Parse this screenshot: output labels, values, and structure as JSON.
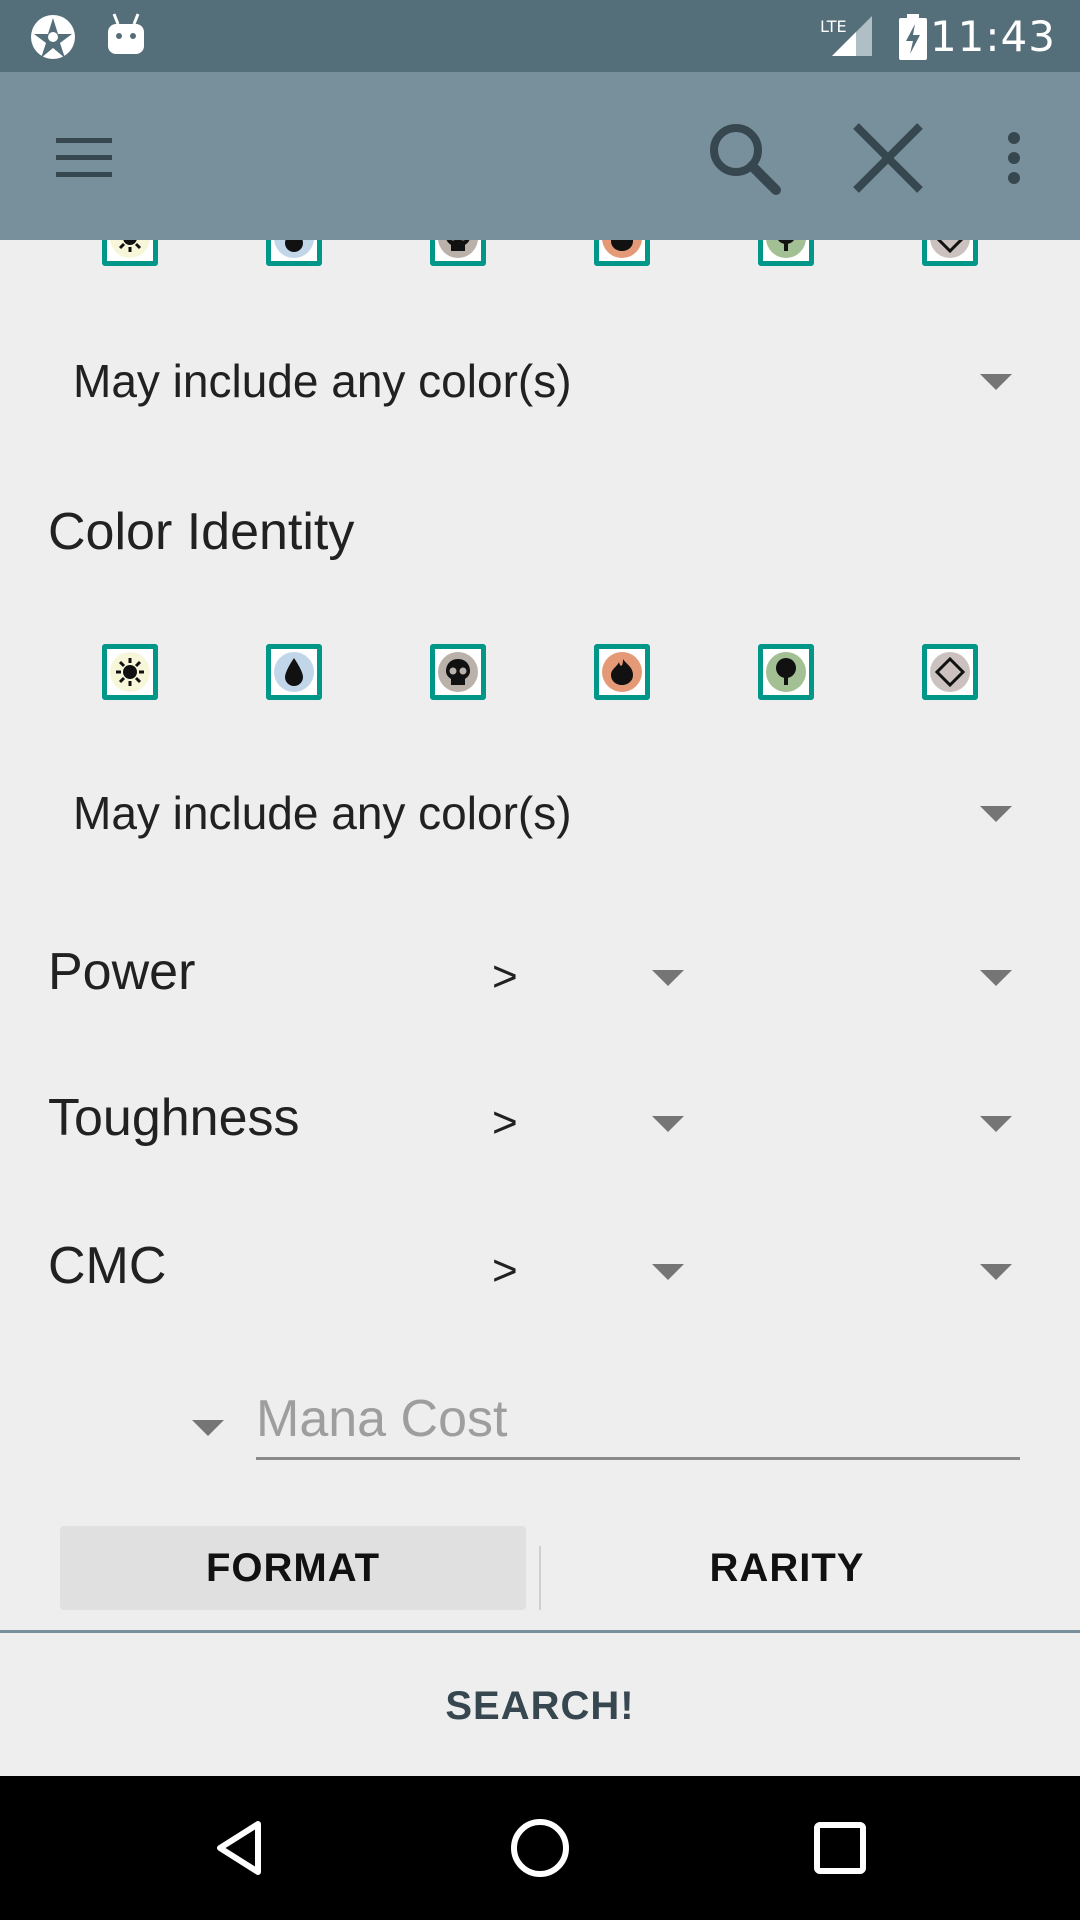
{
  "status_bar": {
    "time": "11:43",
    "network": "LTE",
    "icons": [
      "app-logo-icon",
      "android-debug-icon",
      "lte-signal-icon",
      "battery-charging-icon"
    ]
  },
  "toolbar": {
    "icons": [
      "menu-icon",
      "search-icon",
      "close-icon",
      "overflow-menu-icon"
    ],
    "color": "#78909c"
  },
  "mana_colors": [
    "white",
    "blue",
    "black",
    "red",
    "green",
    "colorless"
  ],
  "color_filter": {
    "dropdown_value": "May include any color(s)"
  },
  "color_identity": {
    "title": "Color Identity",
    "dropdown_value": "May include any color(s)"
  },
  "stats": [
    {
      "label": "Power",
      "operator": ">"
    },
    {
      "label": "Toughness",
      "operator": ">"
    },
    {
      "label": "CMC",
      "operator": ">"
    }
  ],
  "mana_cost": {
    "placeholder": "Mana Cost"
  },
  "tabs": {
    "format": "FORMAT",
    "rarity": "RARITY"
  },
  "search_button": "SEARCH!",
  "nav": [
    "back-icon",
    "home-icon",
    "recents-icon"
  ],
  "accent_color": "#009688"
}
